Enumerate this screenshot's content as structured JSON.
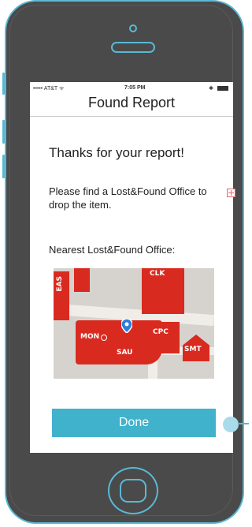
{
  "status_bar": {
    "carrier": "••••• AT&T ᯤ",
    "time": "7:05 PM",
    "battery": "✱"
  },
  "header": {
    "title": "Found Report"
  },
  "content": {
    "thanks": "Thanks for your report!",
    "instruction": "Please find a Lost&Found Office to drop the item.",
    "nearest_label": "Nearest Lost&Found Office:"
  },
  "map": {
    "labels": {
      "eas": "EAS",
      "clk": "CLK",
      "mon": "MON",
      "cpc": "CPC",
      "sau": "SAU",
      "smt": "SMT"
    }
  },
  "actions": {
    "done_label": "Done"
  },
  "colors": {
    "accent": "#41b2cc",
    "phone_outline": "#5ab8d4",
    "phone_body": "#4a4a4a",
    "building": "#d92a1f",
    "pin": "#2a7de1"
  }
}
